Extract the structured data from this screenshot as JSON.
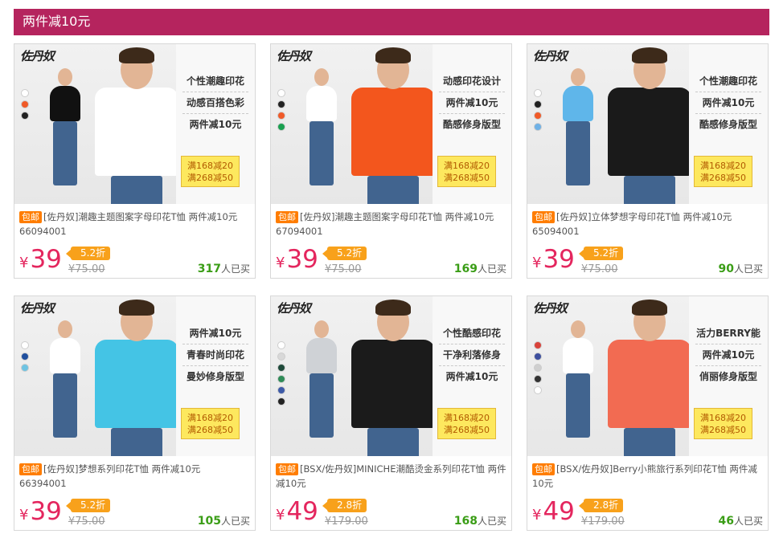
{
  "section": {
    "title": "两件减10元"
  },
  "cards": [
    {
      "brand": "佐丹奴",
      "swatches": [
        "#ffffff",
        "#f05a28",
        "#222222"
      ],
      "features": [
        "个性潮趣印花",
        "动感百搭色彩",
        "两件减10元"
      ],
      "promo": [
        "满168减20",
        "满268减50"
      ],
      "badge": "包邮",
      "title": "[佐丹奴]潮趣主题图案字母印花T恤 两件减10元 66094001",
      "price": "39",
      "currency": "¥",
      "discount": "5.2折",
      "original": "¥75.00",
      "sold_count": "317",
      "sold_suffix": "人已买",
      "shirt_color": "#ffffff",
      "shirt_color2": "#111111"
    },
    {
      "brand": "佐丹奴",
      "swatches": [
        "#ffffff",
        "#222222",
        "#f05a28",
        "#1aa050"
      ],
      "features": [
        "动感印花设计",
        "两件减10元",
        "酷感修身版型"
      ],
      "promo": [
        "满168减20",
        "满268减50"
      ],
      "badge": "包邮",
      "title": "[佐丹奴]潮趣主题图案字母印花T恤 两件减10元 67094001",
      "price": "39",
      "currency": "¥",
      "discount": "5.2折",
      "original": "¥75.00",
      "sold_count": "169",
      "sold_suffix": "人已买",
      "shirt_color": "#f3561d",
      "shirt_color2": "#ffffff"
    },
    {
      "brand": "佐丹奴",
      "swatches": [
        "#ffffff",
        "#222222",
        "#f05a28",
        "#6fb1e6"
      ],
      "features": [
        "个性潮趣印花",
        "两件减10元",
        "酷感修身版型"
      ],
      "promo": [
        "满168减20",
        "满268减50"
      ],
      "badge": "包邮",
      "title": "[佐丹奴]立体梦想字母印花T恤 两件减10元 65094001",
      "price": "39",
      "currency": "¥",
      "discount": "5.2折",
      "original": "¥75.00",
      "sold_count": "90",
      "sold_suffix": "人已买",
      "shirt_color": "#1a1a1a",
      "shirt_color2": "#5fb6ea"
    },
    {
      "brand": "佐丹奴",
      "swatches": [
        "#ffffff",
        "#1f4f9e",
        "#6ec3e2"
      ],
      "features": [
        "两件减10元",
        "青春时尚印花",
        "曼妙修身版型"
      ],
      "promo": [
        "满168减20",
        "满268减50"
      ],
      "badge": "包邮",
      "title": "[佐丹奴]梦想系列印花T恤 两件减10元 66394001",
      "price": "39",
      "currency": "¥",
      "discount": "5.2折",
      "original": "¥75.00",
      "sold_count": "105",
      "sold_suffix": "人已买",
      "shirt_color": "#44c4e5",
      "shirt_color2": "#ffffff"
    },
    {
      "brand": "佐丹奴",
      "swatches": [
        "#ffffff",
        "#d8d8d8",
        "#1e4a3a",
        "#2e8b57",
        "#3d5aa8",
        "#222222"
      ],
      "features": [
        "个性酷感印花",
        "干净利落修身",
        "两件减10元"
      ],
      "promo": [
        "满168减20",
        "满268减50"
      ],
      "badge": "包邮",
      "title": "[BSX/佐丹奴]MINICHE潮酷烫金系列印花T恤 两件减10元",
      "price": "49",
      "currency": "¥",
      "discount": "2.8折",
      "original": "¥179.00",
      "sold_count": "168",
      "sold_suffix": "人已买",
      "shirt_color": "#1b1b1b",
      "shirt_color2": "#cfd2d6"
    },
    {
      "brand": "佐丹奴",
      "swatches": [
        "#d9423a",
        "#3d4f9e",
        "#cfcfcf",
        "#333333",
        "#ffffff"
      ],
      "features": [
        "活力BERRY能",
        "两件减10元",
        "俏丽修身版型"
      ],
      "promo": [
        "满168减20",
        "满268减50"
      ],
      "badge": "包邮",
      "title": "[BSX/佐丹奴]Berry小熊旅行系列印花T恤 两件减10元",
      "price": "49",
      "currency": "¥",
      "discount": "2.8折",
      "original": "¥179.00",
      "sold_count": "46",
      "sold_suffix": "人已买",
      "shirt_color": "#f26b52",
      "shirt_color2": "#ffffff"
    }
  ]
}
